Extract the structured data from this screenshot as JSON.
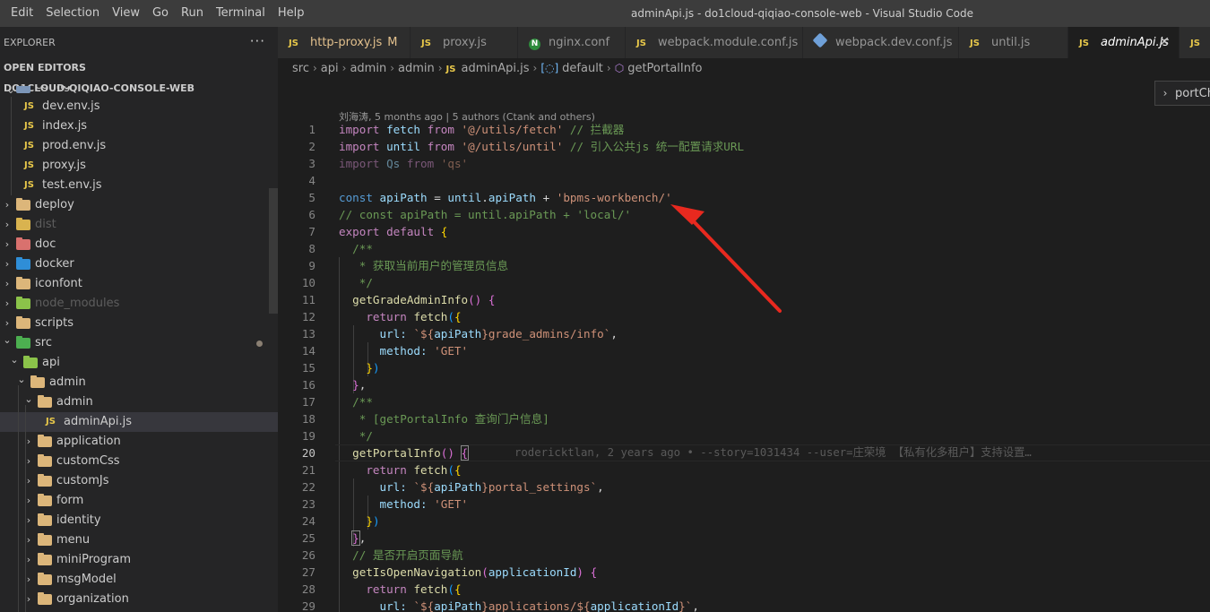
{
  "menu": [
    "Edit",
    "Selection",
    "View",
    "Go",
    "Run",
    "Terminal",
    "Help"
  ],
  "window_title": "adminApi.js - do1cloud-qiqiao-console-web - Visual Studio Code",
  "explorer": {
    "title": "EXPLORER",
    "more_label": "···",
    "open_editors": "OPEN EDITORS",
    "project": "DO1CLOUD-QIQIAO-CONSOLE-WEB",
    "partial_item": "config",
    "items": [
      {
        "label": "dev.env.js",
        "kind": "js"
      },
      {
        "label": "index.js",
        "kind": "js"
      },
      {
        "label": "prod.env.js",
        "kind": "js"
      },
      {
        "label": "proxy.js",
        "kind": "js"
      },
      {
        "label": "test.env.js",
        "kind": "js"
      },
      {
        "label": "deploy",
        "kind": "folder",
        "color": "#dcb67a"
      },
      {
        "label": "dist",
        "kind": "folder",
        "color": "#d9b34f"
      },
      {
        "label": "doc",
        "kind": "folder",
        "color": "#d9716e"
      },
      {
        "label": "docker",
        "kind": "folder",
        "color": "#2f8ed7"
      },
      {
        "label": "iconfont",
        "kind": "folder",
        "color": "#dcb67a"
      },
      {
        "label": "node_modules",
        "kind": "folder",
        "color": "#8bc34a"
      },
      {
        "label": "scripts",
        "kind": "folder",
        "color": "#dcb67a"
      },
      {
        "label": "src",
        "kind": "folder",
        "color": "#4caf50"
      },
      {
        "label": "api",
        "kind": "folder",
        "color": "#8bc34a"
      },
      {
        "label": "admin",
        "kind": "folder",
        "color": "#dcb67a"
      },
      {
        "label": "admin",
        "kind": "folder",
        "color": "#dcb67a"
      },
      {
        "label": "adminApi.js",
        "kind": "js"
      },
      {
        "label": "application",
        "kind": "folder",
        "color": "#dcb67a"
      },
      {
        "label": "customCss",
        "kind": "folder",
        "color": "#dcb67a"
      },
      {
        "label": "customJs",
        "kind": "folder",
        "color": "#dcb67a"
      },
      {
        "label": "form",
        "kind": "folder",
        "color": "#dcb67a"
      },
      {
        "label": "identity",
        "kind": "folder",
        "color": "#dcb67a"
      },
      {
        "label": "menu",
        "kind": "folder",
        "color": "#dcb67a"
      },
      {
        "label": "miniProgram",
        "kind": "folder",
        "color": "#dcb67a"
      },
      {
        "label": "msgModel",
        "kind": "folder",
        "color": "#dcb67a"
      },
      {
        "label": "organization",
        "kind": "folder",
        "color": "#dcb67a"
      }
    ]
  },
  "tabs": [
    {
      "label": "http-proxy.js",
      "icon": "JS",
      "badge": "M"
    },
    {
      "label": "proxy.js",
      "icon": "JS"
    },
    {
      "label": "nginx.conf",
      "icon": "N"
    },
    {
      "label": "webpack.module.conf.js",
      "icon": "JS"
    },
    {
      "label": "webpack.dev.conf.js",
      "icon": "webpack-icon"
    },
    {
      "label": "until.js",
      "icon": "JS"
    },
    {
      "label": "adminApi.js",
      "icon": "JS"
    },
    {
      "label": "",
      "icon": "JS"
    }
  ],
  "close_symbol": "✕",
  "js_badge": "JS",
  "breadcrumb": [
    "src",
    "api",
    "admin",
    "admin",
    "adminApi.js",
    "default",
    "getPortalInfo"
  ],
  "peek": {
    "label": "portCh"
  },
  "blame": {
    "header": "刘海涛, 5 months ago | 5 authors (Ctank and others)",
    "inline": "rodericktlan, 2 years ago • --story=1031434 --user=庄荣境 【私有化多租户】支持设置…"
  },
  "code": {
    "line_numbers": [
      "1",
      "2",
      "3",
      "4",
      "5",
      "6",
      "7",
      "8",
      "9",
      "10",
      "11",
      "12",
      "13",
      "14",
      "15",
      "16",
      "17",
      "18",
      "19",
      "20",
      "21",
      "22",
      "23",
      "24",
      "25",
      "26",
      "27",
      "28",
      "29"
    ],
    "lines": [
      [
        "import",
        "fetch",
        "from",
        "'@/utils/fetch'",
        "// 拦截器"
      ],
      [
        "import",
        "until",
        "from",
        "'@/utils/until'",
        "// 引入公共js 统一配置请求URL"
      ],
      [
        "import",
        "Qs",
        "from",
        "'qs'"
      ],
      [],
      [
        "const",
        "apiPath",
        "=",
        "until",
        ".",
        "apiPath",
        "+",
        "'bpms-workbench/'"
      ],
      [
        "// const apiPath = until.apiPath + 'local/'"
      ],
      [
        "export",
        "default",
        "{"
      ],
      [
        "/**"
      ],
      [
        "* 获取当前用户的管理员信息"
      ],
      [
        "*/"
      ],
      [
        "getGradeAdminInfo",
        "()",
        "{"
      ],
      [
        "return",
        "fetch",
        "(",
        "{"
      ],
      [
        "url:",
        "`${",
        "apiPath",
        "}grade_admins/info`",
        ","
      ],
      [
        "method:",
        "'GET'"
      ],
      [
        "}",
        ")"
      ],
      [
        "}",
        ","
      ],
      [
        "/**"
      ],
      [
        "* [getPortalInfo 查询门户信息]"
      ],
      [
        "*/"
      ],
      [
        "getPortalInfo",
        "()",
        "{"
      ],
      [
        "return",
        "fetch",
        "(",
        "{"
      ],
      [
        "url:",
        "`${",
        "apiPath",
        "}portal_settings`",
        ","
      ],
      [
        "method:",
        "'GET'"
      ],
      [
        "}",
        ")"
      ],
      [
        "}",
        ","
      ],
      [
        "// 是否开启页面导航"
      ],
      [
        "getIsOpenNavigation",
        "(",
        "applicationId",
        ")",
        "{"
      ],
      [
        "return",
        "fetch",
        "(",
        "{"
      ],
      [
        "url:",
        "`${",
        "apiPath",
        "}applications/${",
        "applicationId",
        "}`",
        ","
      ]
    ]
  },
  "colors": {
    "keyword": "#569cd6",
    "control": "#c586c0",
    "variable": "#9cdcfe",
    "function": "#dcdcaa",
    "string": "#ce9178",
    "comment": "#6a9955",
    "annotation_arrow": "#e8291f"
  }
}
